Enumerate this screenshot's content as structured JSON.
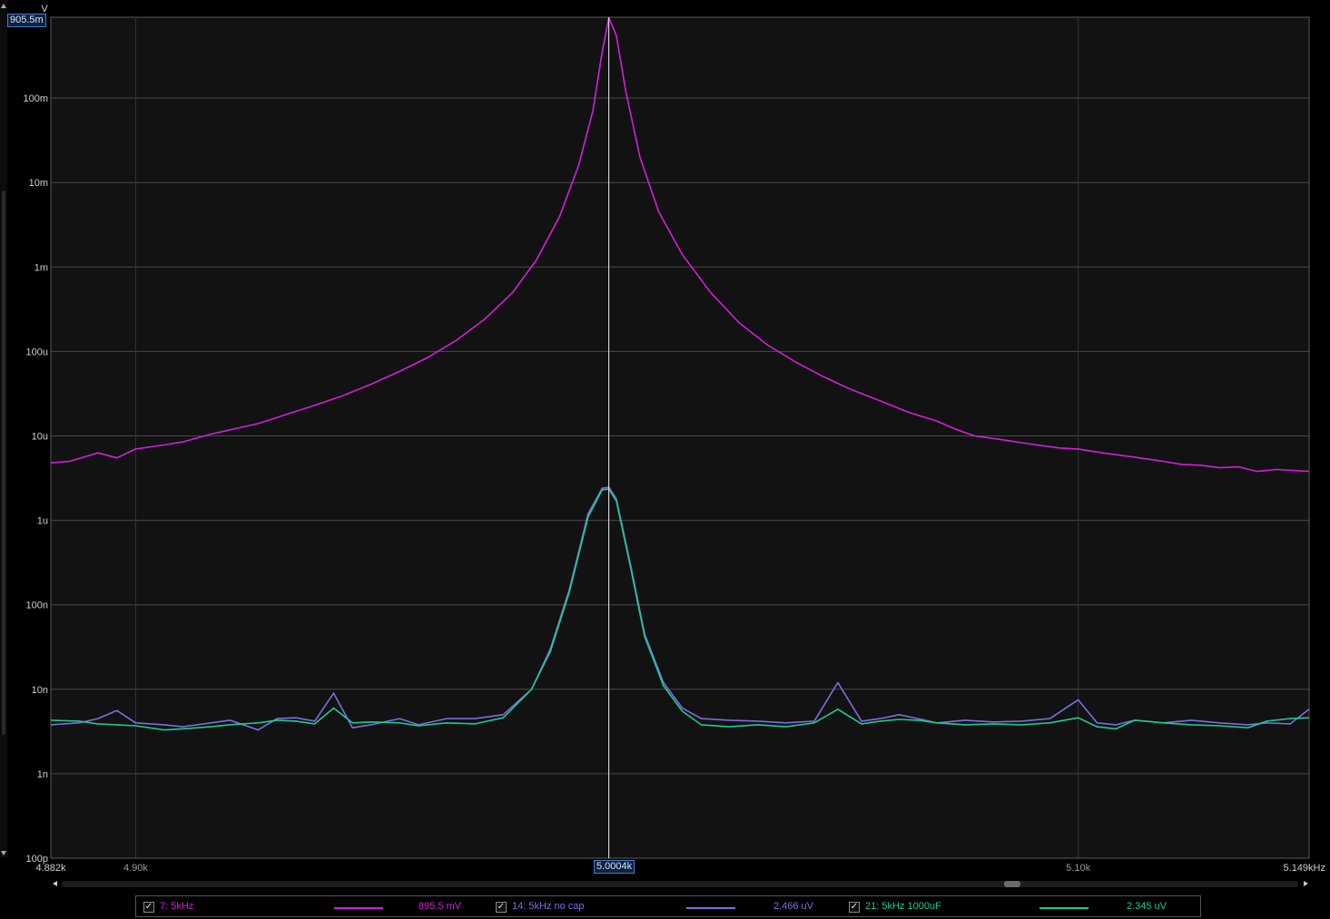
{
  "chart_data": {
    "type": "line",
    "yaxis": {
      "scale": "log",
      "unit_label": "V",
      "range": [
        1e-10,
        0.9055
      ],
      "ticks": [
        {
          "value": 0.1,
          "label": "100m"
        },
        {
          "value": 0.01,
          "label": "10m"
        },
        {
          "value": 0.001,
          "label": "1m"
        },
        {
          "value": 0.0001,
          "label": "100u"
        },
        {
          "value": 1e-05,
          "label": "10u"
        },
        {
          "value": 1e-06,
          "label": "1u"
        },
        {
          "value": 1e-07,
          "label": "100n"
        },
        {
          "value": 1e-08,
          "label": "10n"
        },
        {
          "value": 1e-09,
          "label": "1n"
        },
        {
          "value": 1e-10,
          "label": "100p"
        }
      ],
      "top_label": "905.5m"
    },
    "xaxis": {
      "scale": "linear",
      "range": [
        4882,
        5149
      ],
      "unit": "Hz",
      "start_label": "4.882k",
      "end_label": "5.149kHz",
      "ticks": [
        {
          "value": 4900,
          "label": "4.90k"
        },
        {
          "value": 5100,
          "label": "5.10k"
        }
      ]
    },
    "grid": true,
    "cursor": {
      "x": 5000.4,
      "label": "5.0004k"
    },
    "series": [
      {
        "name": "7: 5kHz",
        "color": "#d020d8",
        "readout": "895.5 mV",
        "checked": true,
        "points": [
          [
            4882,
            4.8e-06
          ],
          [
            4886,
            5e-06
          ],
          [
            4892,
            6.3e-06
          ],
          [
            4896,
            5.5e-06
          ],
          [
            4900,
            7e-06
          ],
          [
            4906,
            7.8e-06
          ],
          [
            4910,
            8.5e-06
          ],
          [
            4916,
            1.05e-05
          ],
          [
            4920,
            1.18e-05
          ],
          [
            4926,
            1.4e-05
          ],
          [
            4932,
            1.8e-05
          ],
          [
            4938,
            2.3e-05
          ],
          [
            4944,
            3e-05
          ],
          [
            4950,
            4.1e-05
          ],
          [
            4956,
            5.8e-05
          ],
          [
            4962,
            8.5e-05
          ],
          [
            4968,
            0.000135
          ],
          [
            4974,
            0.00024
          ],
          [
            4980,
            0.0005
          ],
          [
            4985,
            0.0012
          ],
          [
            4990,
            0.004
          ],
          [
            4994,
            0.016
          ],
          [
            4997,
            0.07
          ],
          [
            4999,
            0.35
          ],
          [
            5000.4,
            0.8955
          ],
          [
            5002,
            0.55
          ],
          [
            5004,
            0.12
          ],
          [
            5007,
            0.02
          ],
          [
            5011,
            0.0045
          ],
          [
            5016,
            0.0014
          ],
          [
            5022,
            0.0005
          ],
          [
            5028,
            0.00022
          ],
          [
            5034,
            0.00012
          ],
          [
            5040,
            7.5e-05
          ],
          [
            5046,
            5e-05
          ],
          [
            5052,
            3.5e-05
          ],
          [
            5058,
            2.6e-05
          ],
          [
            5064,
            1.9e-05
          ],
          [
            5070,
            1.5e-05
          ],
          [
            5074,
            1.2e-05
          ],
          [
            5078,
            1e-05
          ],
          [
            5084,
            9e-06
          ],
          [
            5090,
            8e-06
          ],
          [
            5096,
            7.2e-06
          ],
          [
            5100,
            7e-06
          ],
          [
            5106,
            6.2e-06
          ],
          [
            5112,
            5.6e-06
          ],
          [
            5118,
            5e-06
          ],
          [
            5122,
            4.6e-06
          ],
          [
            5126,
            4.5e-06
          ],
          [
            5130,
            4.2e-06
          ],
          [
            5134,
            4.3e-06
          ],
          [
            5138,
            3.8e-06
          ],
          [
            5142,
            4e-06
          ],
          [
            5149,
            3.8e-06
          ]
        ]
      },
      {
        "name": "14: 5kHz no cap",
        "color": "#7a6ee0",
        "readout": "2.466 uV",
        "checked": true,
        "points": [
          [
            4882,
            3.8e-09
          ],
          [
            4888,
            4e-09
          ],
          [
            4892,
            4.5e-09
          ],
          [
            4896,
            5.6e-09
          ],
          [
            4900,
            4e-09
          ],
          [
            4906,
            3.8e-09
          ],
          [
            4910,
            3.6e-09
          ],
          [
            4916,
            4e-09
          ],
          [
            4920,
            4.3e-09
          ],
          [
            4926,
            3.3e-09
          ],
          [
            4930,
            4.5e-09
          ],
          [
            4934,
            4.6e-09
          ],
          [
            4938,
            4.2e-09
          ],
          [
            4942,
            9e-09
          ],
          [
            4946,
            3.5e-09
          ],
          [
            4950,
            3.8e-09
          ],
          [
            4956,
            4.5e-09
          ],
          [
            4960,
            3.8e-09
          ],
          [
            4966,
            4.5e-09
          ],
          [
            4972,
            4.5e-09
          ],
          [
            4978,
            5e-09
          ],
          [
            4984,
            1e-08
          ],
          [
            4988,
            3e-08
          ],
          [
            4992,
            1.5e-07
          ],
          [
            4996,
            1.2e-06
          ],
          [
            4999,
            2.4e-06
          ],
          [
            5000.4,
            2.466e-06
          ],
          [
            5002,
            1.8e-06
          ],
          [
            5005,
            3e-07
          ],
          [
            5008,
            4.5e-08
          ],
          [
            5012,
            1.2e-08
          ],
          [
            5016,
            6e-09
          ],
          [
            5020,
            4.5e-09
          ],
          [
            5026,
            4.3e-09
          ],
          [
            5032,
            4.2e-09
          ],
          [
            5038,
            4e-09
          ],
          [
            5044,
            4.2e-09
          ],
          [
            5049,
            1.2e-08
          ],
          [
            5054,
            4.2e-09
          ],
          [
            5058,
            4.5e-09
          ],
          [
            5062,
            5e-09
          ],
          [
            5066,
            4.5e-09
          ],
          [
            5070,
            4e-09
          ],
          [
            5076,
            4.3e-09
          ],
          [
            5082,
            4.1e-09
          ],
          [
            5088,
            4.2e-09
          ],
          [
            5094,
            4.5e-09
          ],
          [
            5100,
            7.5e-09
          ],
          [
            5104,
            4e-09
          ],
          [
            5108,
            3.8e-09
          ],
          [
            5112,
            4.3e-09
          ],
          [
            5118,
            4e-09
          ],
          [
            5124,
            4.3e-09
          ],
          [
            5130,
            4e-09
          ],
          [
            5136,
            3.8e-09
          ],
          [
            5140,
            4e-09
          ],
          [
            5145,
            3.9e-09
          ],
          [
            5149,
            5.8e-09
          ]
        ]
      },
      {
        "name": "21: 5kHz 1000uF",
        "color": "#20c890",
        "readout": "2.345 uV",
        "checked": true,
        "points": [
          [
            4882,
            4.3e-09
          ],
          [
            4888,
            4.2e-09
          ],
          [
            4892,
            3.9e-09
          ],
          [
            4896,
            3.8e-09
          ],
          [
            4900,
            3.7e-09
          ],
          [
            4906,
            3.3e-09
          ],
          [
            4910,
            3.4e-09
          ],
          [
            4916,
            3.6e-09
          ],
          [
            4920,
            3.8e-09
          ],
          [
            4926,
            4e-09
          ],
          [
            4930,
            4.3e-09
          ],
          [
            4934,
            4.2e-09
          ],
          [
            4938,
            3.9e-09
          ],
          [
            4942,
            6e-09
          ],
          [
            4946,
            4e-09
          ],
          [
            4950,
            4.1e-09
          ],
          [
            4956,
            4e-09
          ],
          [
            4960,
            3.7e-09
          ],
          [
            4966,
            4e-09
          ],
          [
            4972,
            3.9e-09
          ],
          [
            4978,
            4.6e-09
          ],
          [
            4984,
            1e-08
          ],
          [
            4988,
            2.8e-08
          ],
          [
            4992,
            1.4e-07
          ],
          [
            4996,
            1.1e-06
          ],
          [
            4999,
            2.3e-06
          ],
          [
            5000.4,
            2.345e-06
          ],
          [
            5002,
            1.7e-06
          ],
          [
            5005,
            2.8e-07
          ],
          [
            5008,
            4.2e-08
          ],
          [
            5012,
            1.1e-08
          ],
          [
            5016,
            5.5e-09
          ],
          [
            5020,
            3.8e-09
          ],
          [
            5026,
            3.6e-09
          ],
          [
            5032,
            3.8e-09
          ],
          [
            5038,
            3.6e-09
          ],
          [
            5044,
            4e-09
          ],
          [
            5049,
            5.8e-09
          ],
          [
            5054,
            3.9e-09
          ],
          [
            5058,
            4.2e-09
          ],
          [
            5062,
            4.4e-09
          ],
          [
            5066,
            4.3e-09
          ],
          [
            5070,
            4e-09
          ],
          [
            5076,
            3.8e-09
          ],
          [
            5082,
            3.9e-09
          ],
          [
            5088,
            3.8e-09
          ],
          [
            5094,
            4e-09
          ],
          [
            5100,
            4.6e-09
          ],
          [
            5104,
            3.6e-09
          ],
          [
            5108,
            3.4e-09
          ],
          [
            5112,
            4.3e-09
          ],
          [
            5118,
            4e-09
          ],
          [
            5124,
            3.8e-09
          ],
          [
            5130,
            3.7e-09
          ],
          [
            5136,
            3.5e-09
          ],
          [
            5140,
            4.2e-09
          ],
          [
            5145,
            4.5e-09
          ],
          [
            5149,
            4.6e-09
          ]
        ]
      }
    ]
  },
  "legend": [
    {
      "name": "7: 5kHz",
      "readout": "895.5 mV",
      "color": "#d020d8",
      "check": "✓"
    },
    {
      "name": "14: 5kHz no cap",
      "readout": "2.466 uV",
      "color": "#7a6ee0",
      "check": "✓"
    },
    {
      "name": "21: 5kHz 1000uF",
      "readout": "2.345 uV",
      "color": "#20c890",
      "check": "✓"
    }
  ]
}
